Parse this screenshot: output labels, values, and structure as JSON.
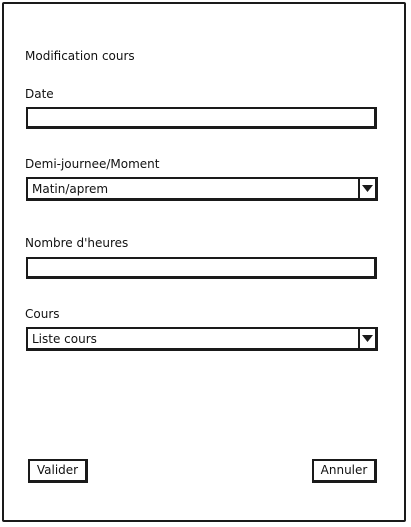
{
  "form": {
    "title": "Modification cours",
    "date": {
      "label": "Date",
      "value": ""
    },
    "moment": {
      "label": "Demi-journee/Moment",
      "selected": "Matin/aprem",
      "arrow_icon": "chevron-down-icon"
    },
    "hours": {
      "label": "Nombre d'heures",
      "value": ""
    },
    "course": {
      "label": "Cours",
      "selected": "Liste cours",
      "arrow_icon": "chevron-down-icon"
    },
    "buttons": {
      "validate_label": "Valider",
      "cancel_label": "Annuler"
    }
  }
}
